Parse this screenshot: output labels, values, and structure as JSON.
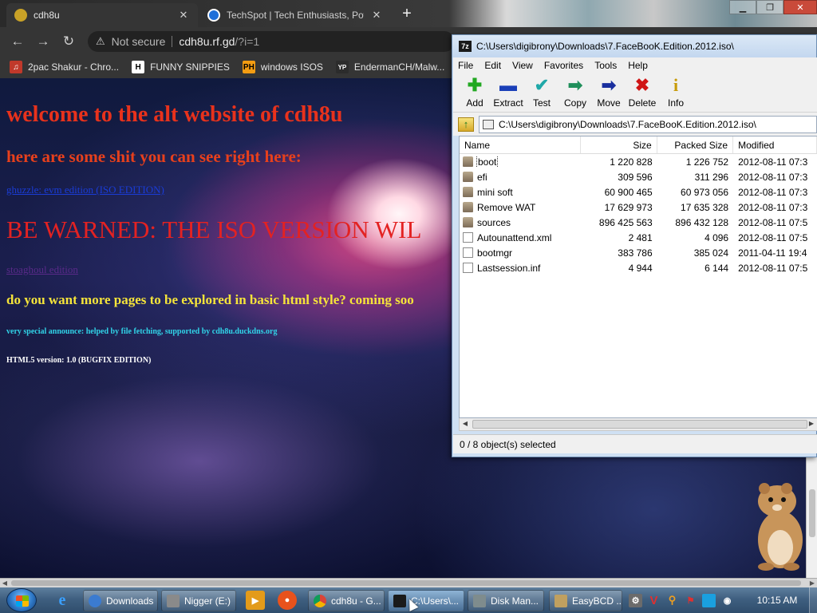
{
  "browser": {
    "tabs": [
      {
        "title": "cdh8u",
        "favicon_color": "#c9a227",
        "active": true
      },
      {
        "title": "TechSpot | Tech Enthusiasts, Pow",
        "favicon_color": "#1e6fd9",
        "active": false
      }
    ],
    "new_tab_label": "+",
    "address": {
      "security_label": "Not secure",
      "host": "cdh8u.rf.gd",
      "path": "/?i=1"
    },
    "bookmarks": [
      {
        "label": "2pac Shakur - Chro...",
        "icon": "folder-icon",
        "color": "#c0392b"
      },
      {
        "label": "FUNNY SNIPPIES",
        "icon": "h-icon",
        "color": "#1a1a1a"
      },
      {
        "label": "windows ISOS",
        "icon": "ph-icon",
        "color": "#f39c12"
      },
      {
        "label": "EndermanCH/Malw...",
        "icon": "yp-icon",
        "color": "#2c2c2c"
      }
    ]
  },
  "page": {
    "heading": "welcome to the alt website of cdh8u",
    "subheading": "here are some shit you can see right here:",
    "link1": "ghuzzle: evm edition (ISO EDITION)",
    "warning": "BE WARNED: THE ISO VERSION WIL",
    "link2": "stoaghoul edition",
    "more_pages": "do you want more pages to be explored in basic html style? coming soo",
    "announce": "very special announce: helped by file fetching, supported by cdh8u.duckdns.org",
    "version": "HTML5 version: 1.0 (BUGFIX EDITION)"
  },
  "zip": {
    "title": "C:\\Users\\digibrony\\Downloads\\7.FaceBooK.Edition.2012.iso\\",
    "menu": [
      "File",
      "Edit",
      "View",
      "Favorites",
      "Tools",
      "Help"
    ],
    "tools": [
      {
        "label": "Add",
        "glyph": "✚",
        "color": "#22a822"
      },
      {
        "label": "Extract",
        "glyph": "▬",
        "color": "#1a3fb8"
      },
      {
        "label": "Test",
        "glyph": "✔",
        "color": "#1fa8a8"
      },
      {
        "label": "Copy",
        "glyph": "➡",
        "color": "#1f8f5a"
      },
      {
        "label": "Move",
        "glyph": "➡",
        "color": "#1a2f9e"
      },
      {
        "label": "Delete",
        "glyph": "✖",
        "color": "#d01515"
      },
      {
        "label": "Info",
        "glyph": "i",
        "color": "#c89b0a"
      }
    ],
    "path": "C:\\Users\\digibrony\\Downloads\\7.FaceBooK.Edition.2012.iso\\",
    "columns": {
      "name": "Name",
      "size": "Size",
      "packed": "Packed Size",
      "modified": "Modified"
    },
    "rows": [
      {
        "name": "boot",
        "type": "folder",
        "size": "1 220 828",
        "packed": "1 226 752",
        "modified": "2012-08-11 07:3",
        "selected": true
      },
      {
        "name": "efi",
        "type": "folder",
        "size": "309 596",
        "packed": "311 296",
        "modified": "2012-08-11 07:3",
        "selected": false
      },
      {
        "name": "mini soft",
        "type": "folder",
        "size": "60 900 465",
        "packed": "60 973 056",
        "modified": "2012-08-11 07:3",
        "selected": false
      },
      {
        "name": "Remove WAT",
        "type": "folder",
        "size": "17 629 973",
        "packed": "17 635 328",
        "modified": "2012-08-11 07:3",
        "selected": false
      },
      {
        "name": "sources",
        "type": "folder",
        "size": "896 425 563",
        "packed": "896 432 128",
        "modified": "2012-08-11 07:5",
        "selected": false
      },
      {
        "name": "Autounattend.xml",
        "type": "file",
        "size": "2 481",
        "packed": "4 096",
        "modified": "2012-08-11 07:5",
        "selected": false
      },
      {
        "name": "bootmgr",
        "type": "file",
        "size": "383 786",
        "packed": "385 024",
        "modified": "2011-04-11 19:4",
        "selected": false
      },
      {
        "name": "Lastsession.inf",
        "type": "file",
        "size": "4 944",
        "packed": "6 144",
        "modified": "2012-08-11 07:5",
        "selected": false
      }
    ],
    "status": "0 / 8 object(s) selected"
  },
  "taskbar": {
    "items": [
      {
        "label": "Downloads",
        "icon_color": "#3b7bd0",
        "active": false
      },
      {
        "label": "Nigger (E:)",
        "icon_color": "#8a8a8a",
        "active": false
      },
      {
        "label": "cdh8u - G...",
        "icon_color": "#e0a800",
        "active": false
      },
      {
        "label": "C:\\Users\\...",
        "icon_color": "#1a1a1a",
        "active": true
      },
      {
        "label": "Disk Man...",
        "icon_color": "#7f8c8d",
        "active": false
      },
      {
        "label": "EasyBCD ...",
        "icon_color": "#c0a060",
        "active": false
      }
    ],
    "clock": "10:15 AM"
  }
}
